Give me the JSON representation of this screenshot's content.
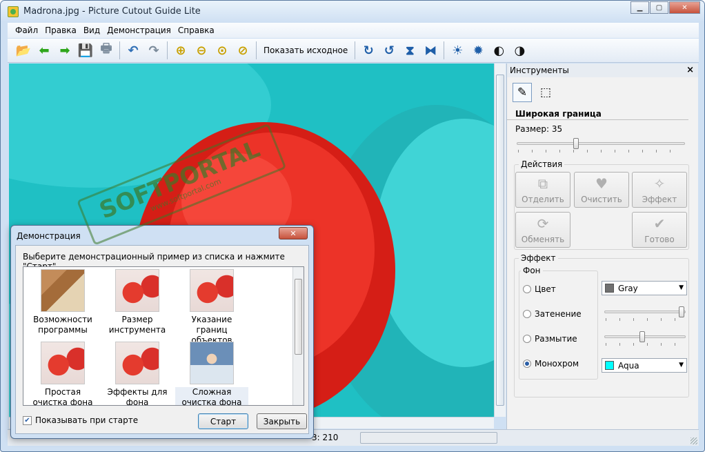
{
  "window": {
    "title": "Madrona.jpg - Picture Cutout Guide Lite"
  },
  "menu": [
    "Файл",
    "Правка",
    "Вид",
    "Демонстрация",
    "Справка"
  ],
  "toolbar": {
    "show_original_label": "Показать исходное"
  },
  "tools_panel": {
    "title": "Инструменты",
    "tool_name": "Широкая граница",
    "size_label": "Размер: 35",
    "size_value": 35,
    "actions_title": "Действия",
    "buttons": {
      "separate": "Отделить",
      "clear": "Очистить",
      "effect": "Эффект",
      "swap": "Обменять",
      "done": "Готово"
    },
    "effect_title": "Эффект",
    "background_title": "Фон",
    "options": {
      "color": "Цвет",
      "shade": "Затенение",
      "blur": "Размытие",
      "mono": "Монохром"
    },
    "color_combo": {
      "value": "Gray",
      "swatch": "#707070"
    },
    "mono_combo": {
      "value": "Aqua",
      "swatch": "#00ffff"
    },
    "shade_level": 1.0,
    "blur_level": 0.47
  },
  "statusbar": {
    "text": "3: 210"
  },
  "demo_dialog": {
    "title": "Демонстрация",
    "instruction": "Выберите демонстрационный пример из списка и нажмите \"Старт\"",
    "items": [
      "Возможности программы",
      "Размер инструмента",
      "Указание границ объектов",
      "Простая очистка фона",
      "Эффекты для фона",
      "Сложная очистка фона"
    ],
    "show_on_start": "Показывать при старте",
    "start_button": "Старт",
    "close_button": "Закрыть"
  },
  "watermark": {
    "main": "SOFTPORTAL",
    "sub": "www.softportal.com"
  },
  "colors": {
    "canvas": "#1fc0c4",
    "berry": "#e42a22"
  }
}
